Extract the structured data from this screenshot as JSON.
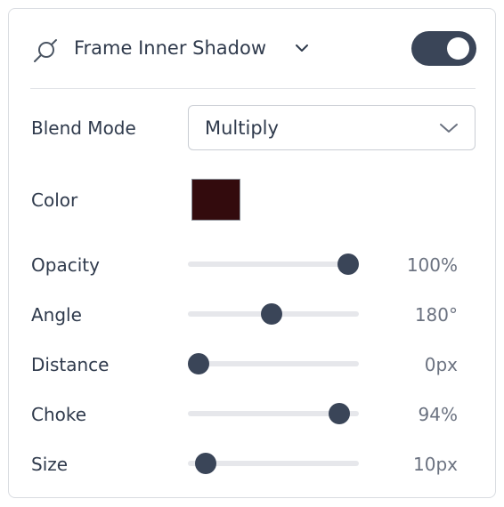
{
  "header": {
    "title": "Frame Inner Shadow",
    "enabled": true,
    "icons": {
      "effect": "shadow-effect-icon",
      "expand": "chevron-down-icon"
    }
  },
  "blend_mode": {
    "label": "Blend Mode",
    "value": "Multiply"
  },
  "color": {
    "label": "Color",
    "value": "#330b0d"
  },
  "sliders": [
    {
      "label": "Opacity",
      "value_text": "100%",
      "fraction": 0.935
    },
    {
      "label": "Angle",
      "value_text": "180°",
      "fraction": 0.49
    },
    {
      "label": "Distance",
      "value_text": "0px",
      "fraction": 0.06
    },
    {
      "label": "Choke",
      "value_text": "94%",
      "fraction": 0.885
    },
    {
      "label": "Size",
      "value_text": "10px",
      "fraction": 0.105
    }
  ],
  "colors": {
    "accent": "#3a4558",
    "track": "#e6e7eb"
  }
}
